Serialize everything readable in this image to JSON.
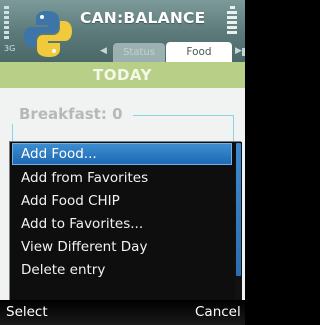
{
  "app": {
    "title": "CAN:BALANCE",
    "network_label": "3G"
  },
  "tabs": {
    "items": [
      {
        "label": "Status",
        "selected": false
      },
      {
        "label": "Food",
        "selected": true
      }
    ]
  },
  "content": {
    "day_label": "TODAY",
    "meal_heading": "Breakfast: 0"
  },
  "menu": {
    "items": [
      {
        "label": "Add Food...",
        "selected": true
      },
      {
        "label": "Add from Favorites",
        "selected": false
      },
      {
        "label": "Add Food CHIP",
        "selected": false
      },
      {
        "label": "Add to Favorites...",
        "selected": false
      },
      {
        "label": "View Different Day",
        "selected": false
      },
      {
        "label": "Delete entry",
        "selected": false
      }
    ]
  },
  "softkeys": {
    "left": "Select",
    "right": "Cancel"
  },
  "colors": {
    "header": "#5b7978",
    "today_bar": "#b7cf86",
    "menu_highlight": "#2b79c3",
    "content_bg": "#f1f2f2",
    "logo_blue": "#3e75a8",
    "logo_yellow": "#f0c93c"
  },
  "icons": {
    "logo": "python-logo-icon",
    "signal": "signal-strength-icon",
    "battery": "battery-level-icon",
    "tab_left": "chevron-left-icon",
    "tab_right": "chevron-right-icon"
  }
}
